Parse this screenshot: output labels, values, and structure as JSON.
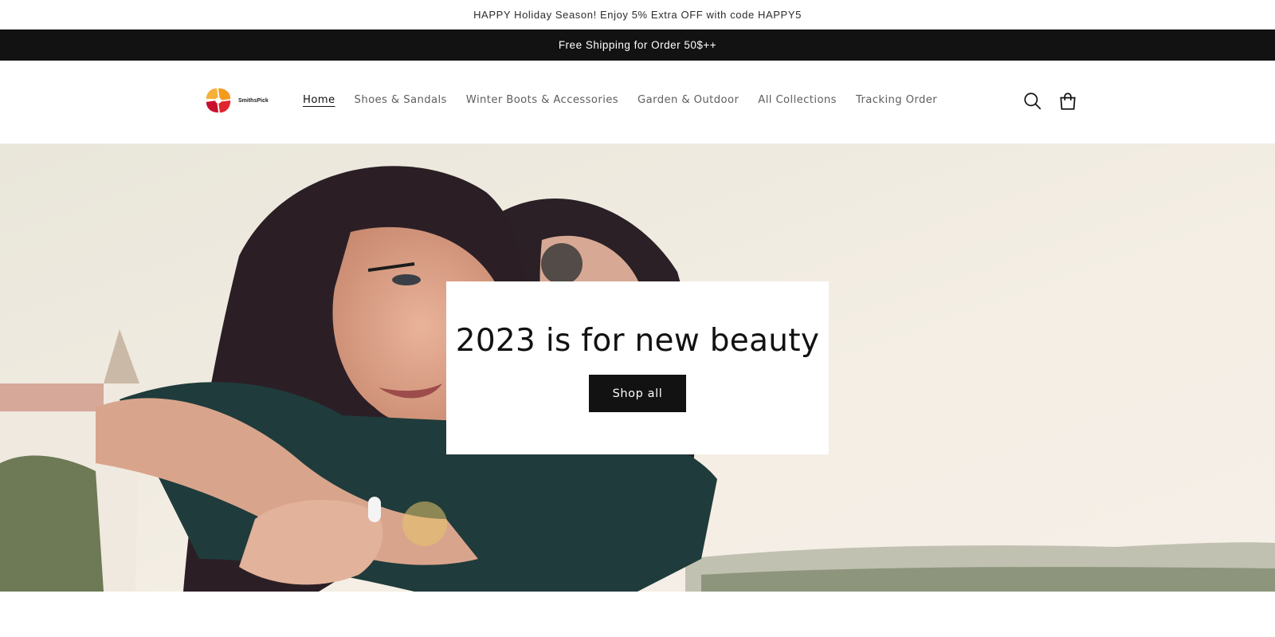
{
  "announcements": {
    "top": "HAPPY Holiday Season! Enjoy 5% Extra OFF with code HAPPY5",
    "bar": "Free Shipping for Order 50$++"
  },
  "header": {
    "logo_text": "SmithsPick",
    "nav": [
      "Home",
      "Shoes & Sandals",
      "Winter Boots & Accessories",
      "Garden & Outdoor",
      "All Collections",
      "Tracking Order"
    ],
    "active_nav": "Home",
    "icons": [
      "search-icon",
      "cart-icon"
    ]
  },
  "hero": {
    "title": "2023 is for new beauty",
    "button_label": "Shop all"
  },
  "colors": {
    "dark": "#121212",
    "white": "#ffffff",
    "nav_text": "#5e5e5e"
  }
}
